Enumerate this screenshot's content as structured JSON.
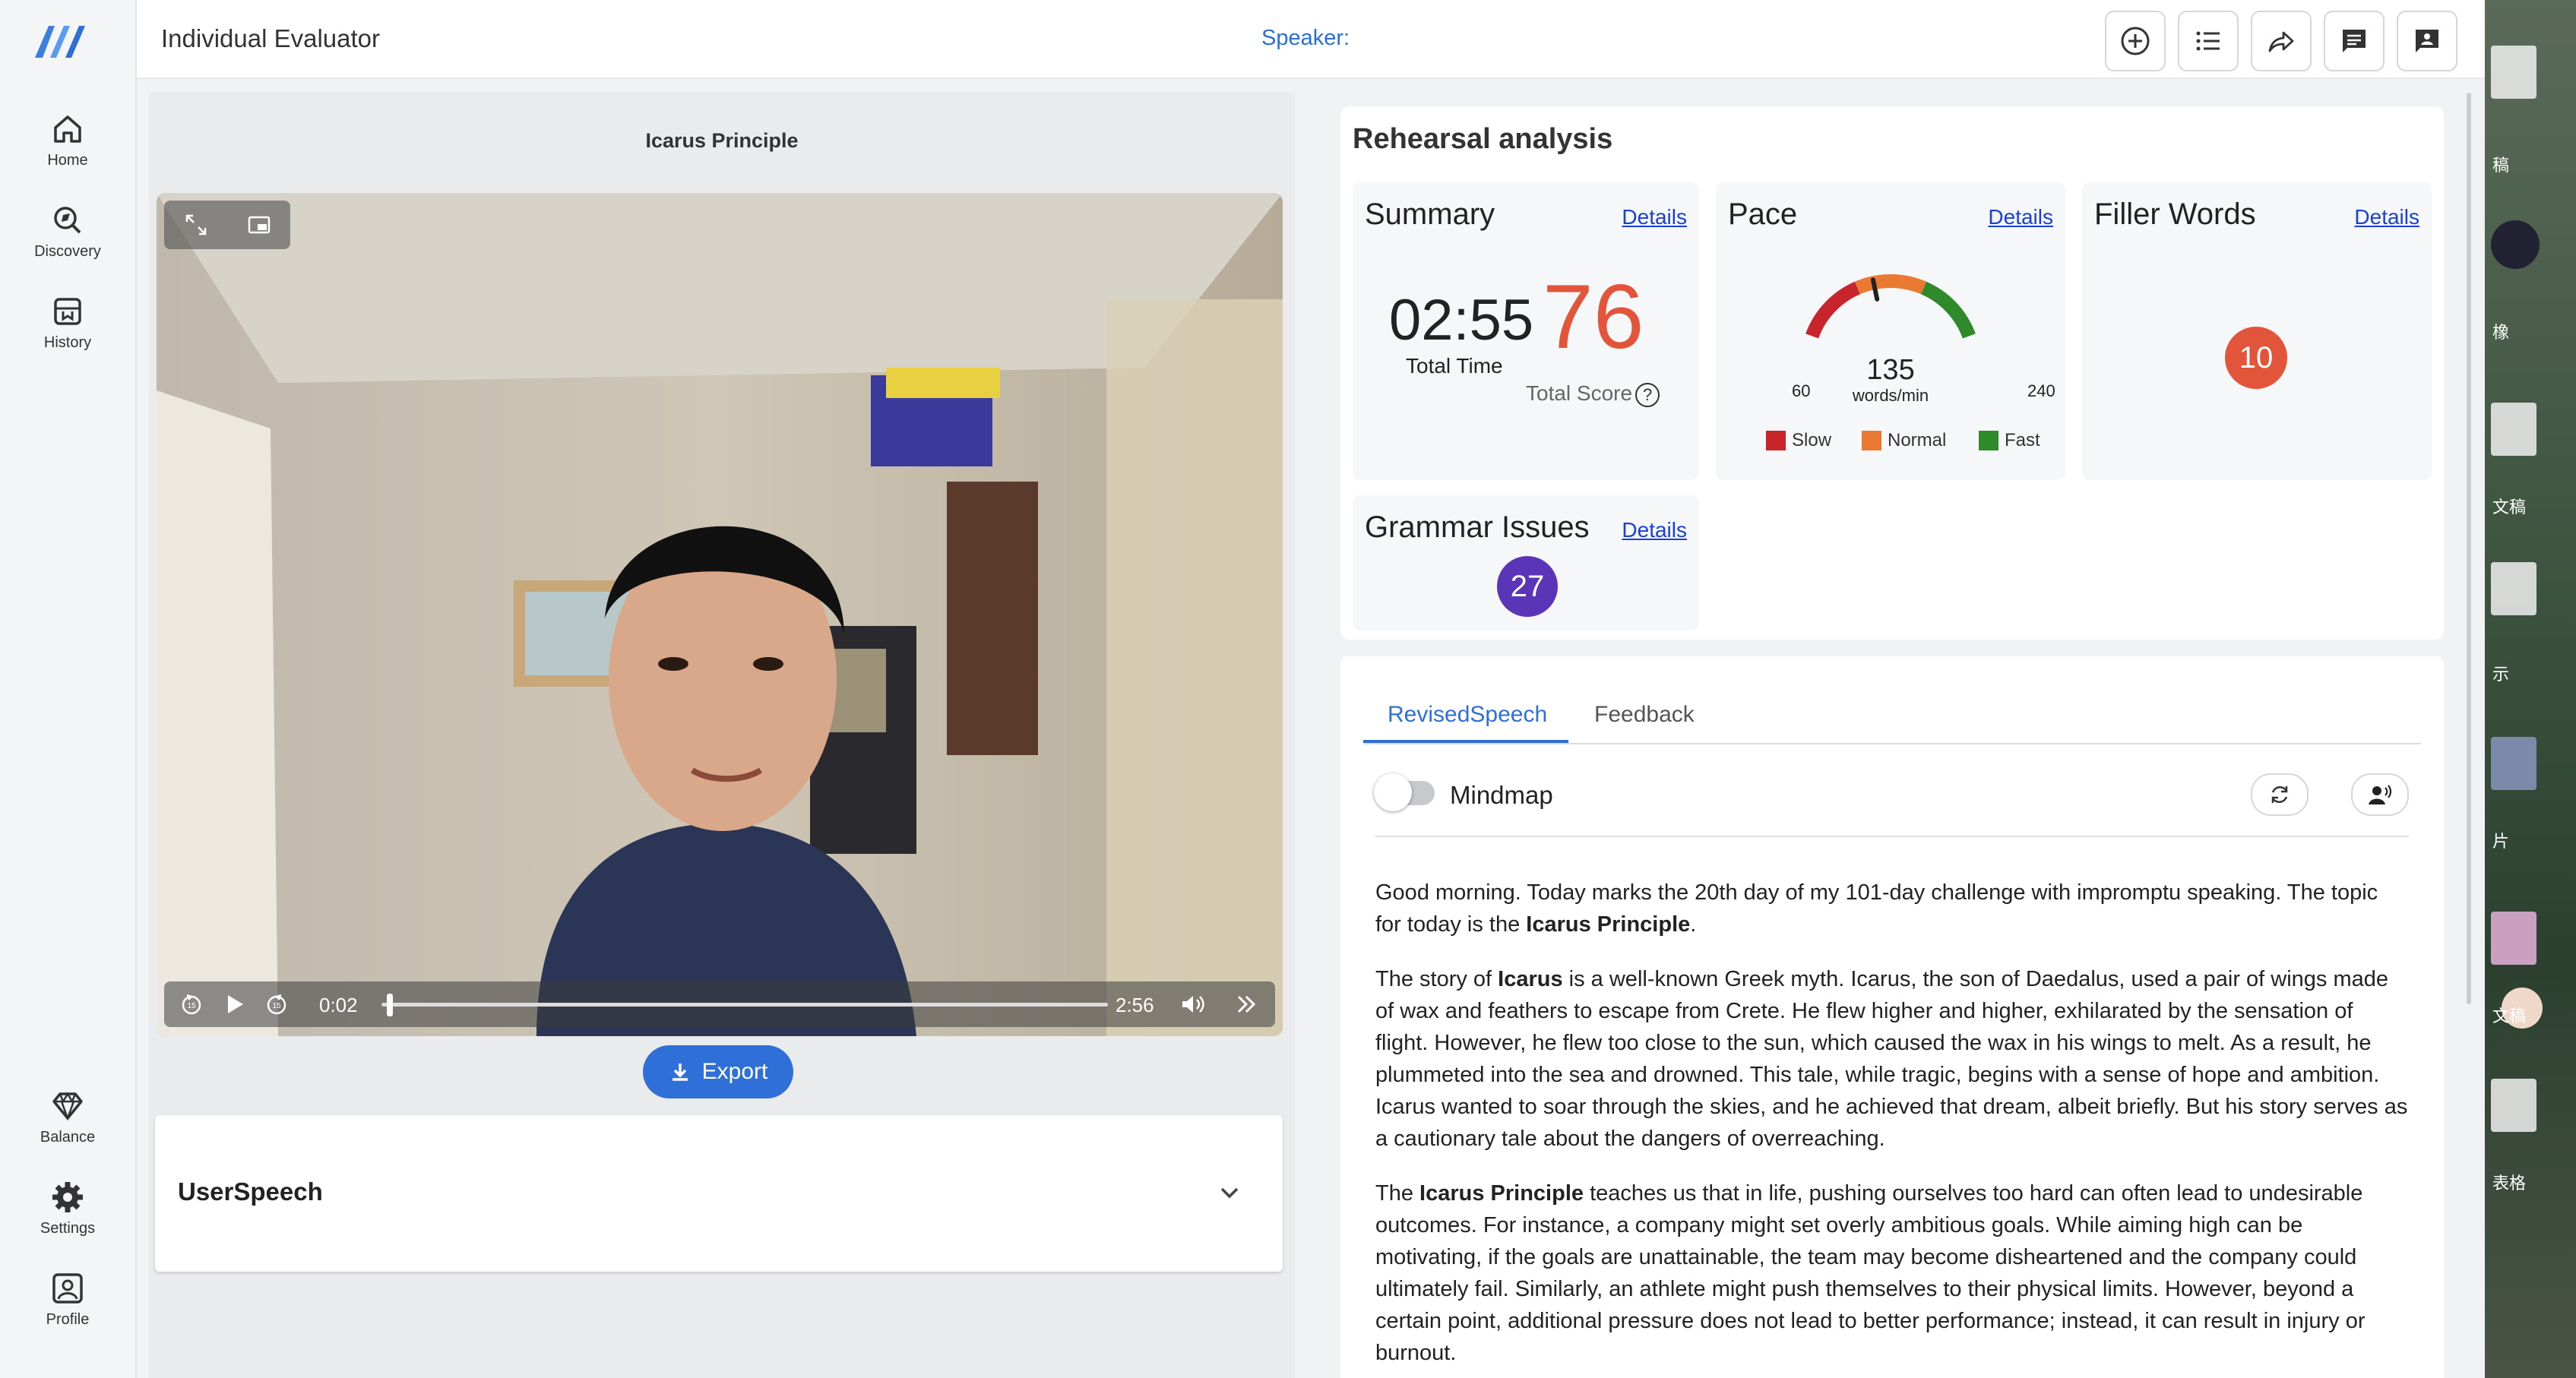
{
  "app": {
    "title": "Individual Evaluator",
    "speaker_label": "Speaker:"
  },
  "sidebar": {
    "items": [
      {
        "label": "Home",
        "icon": "home-icon"
      },
      {
        "label": "Discovery",
        "icon": "discovery-icon"
      },
      {
        "label": "History",
        "icon": "history-icon"
      },
      {
        "label": "Balance",
        "icon": "diamond-icon"
      },
      {
        "label": "Settings",
        "icon": "gear-icon"
      },
      {
        "label": "Profile",
        "icon": "profile-icon"
      }
    ]
  },
  "video": {
    "title": "Icarus Principle",
    "current_time": "0:02",
    "duration": "2:56",
    "progress_fraction": 0.011
  },
  "export_label": "Export",
  "user_speech_header": "UserSpeech",
  "analysis": {
    "title": "Rehearsal analysis",
    "details_label": "Details",
    "summary": {
      "title": "Summary",
      "total_time": "02:55",
      "total_time_label": "Total Time",
      "total_score": "76",
      "total_score_label": "Total Score",
      "help_glyph": "?"
    },
    "pace": {
      "title": "Pace",
      "value": "135",
      "unit": "words/min",
      "min": "60",
      "max": "240",
      "legend": [
        "Slow",
        "Normal",
        "Fast"
      ],
      "colors": {
        "slow": "#c8242b",
        "normal": "#ea7a32",
        "fast": "#2f8a2a"
      }
    },
    "filler": {
      "title": "Filler Words",
      "count": "10",
      "color": "#e2553a"
    },
    "grammar": {
      "title": "Grammar Issues",
      "count": "27",
      "color": "#5b35b8"
    }
  },
  "tabs": [
    {
      "label": "RevisedSpeech",
      "active": true
    },
    {
      "label": "Feedback",
      "active": false
    }
  ],
  "mindmap_label": "Mindmap",
  "speech": {
    "p1_a": "Good morning. Today marks the 20th day of my 101-day challenge with impromptu speaking. The topic for today is the ",
    "p1_b": "Icarus Principle",
    "p1_c": ".",
    "p2_a": "The story of ",
    "p2_b": "Icarus",
    "p2_c": " is a well-known Greek myth. Icarus, the son of Daedalus, used a pair of wings made of wax and feathers to escape from Crete. He flew higher and higher, exhilarated by the sensation of flight. However, he flew too close to the sun, which caused the wax in his wings to melt. As a result, he plummeted into the sea and drowned. This tale, while tragic, begins with a sense of hope and ambition. Icarus wanted to soar through the skies, and he achieved that dream, albeit briefly. But his story serves as a cautionary tale about the dangers of overreaching.",
    "p3_a": "The ",
    "p3_b": "Icarus Principle",
    "p3_c": " teaches us that in life, pushing ourselves too hard can often lead to undesirable outcomes. For instance, a company might set overly ambitious goals. While aiming high can be motivating, if the goals are unattainable, the team may become disheartened and the company could ultimately fail. Similarly, an athlete might push themselves to their physical limits. However, beyond a certain point, additional pressure does not lead to better performance; instead, it can result in injury or burnout."
  },
  "desktop": {
    "labels": [
      "稿",
      "橡",
      "文稿",
      "示",
      "片",
      "文稿",
      "表格"
    ]
  }
}
